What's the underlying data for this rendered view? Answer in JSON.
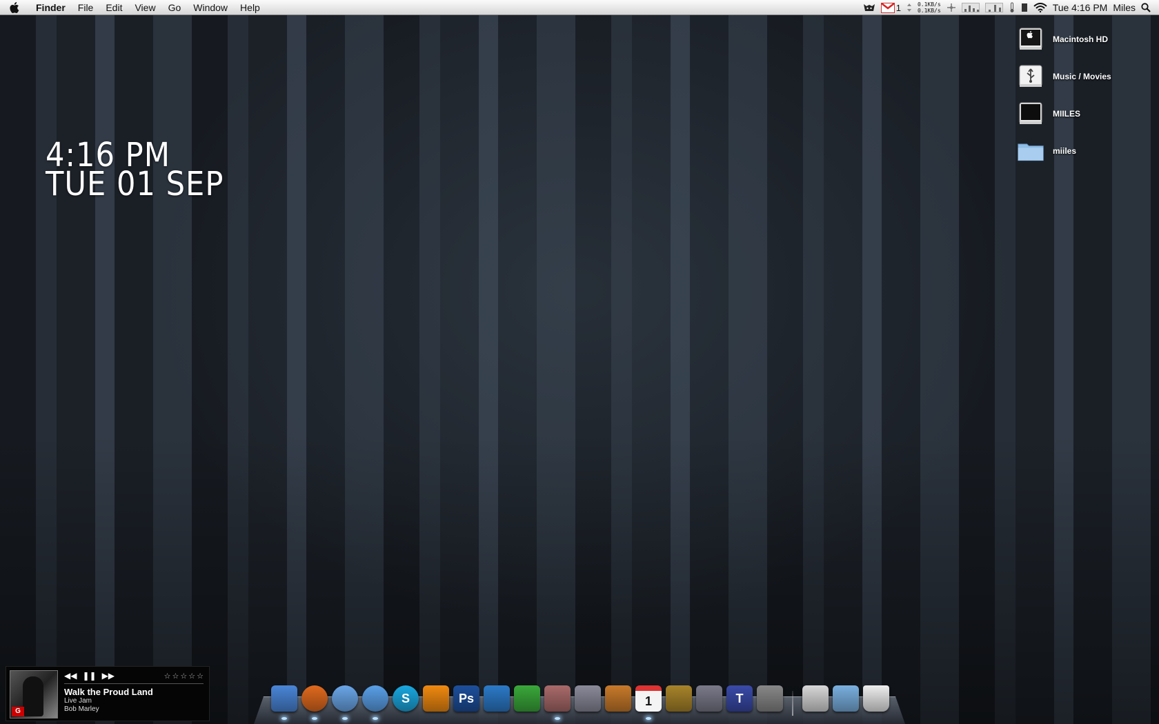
{
  "menubar": {
    "app_name": "Finder",
    "menus": [
      "File",
      "Edit",
      "View",
      "Go",
      "Window",
      "Help"
    ],
    "mail_count": "1",
    "net_up": "0.1KB/s",
    "net_down": "0.1KB/s",
    "clock": "Tue 4:16 PM",
    "user": "Miles"
  },
  "desktop_clock": {
    "time": "4:16 PM",
    "date": "TUE 01 SEP"
  },
  "desktop_icons": [
    {
      "label": "Macintosh HD",
      "icon": "hard-drive-icon"
    },
    {
      "label": "Music / Movies",
      "icon": "usb-drive-icon"
    },
    {
      "label": "MIILES",
      "icon": "external-drive-icon"
    },
    {
      "label": "miiles",
      "icon": "folder-icon"
    }
  ],
  "now_playing": {
    "title": "Walk the Proud Land",
    "album": "Live Jam",
    "artist": "Bob Marley",
    "rating_stars": 0
  },
  "dock": {
    "apps": [
      {
        "name": "finder",
        "color": "#4a86d8",
        "running": true
      },
      {
        "name": "firefox",
        "color": "#e06a1e",
        "running": true
      },
      {
        "name": "itunes",
        "color": "#6aa6e8",
        "running": true
      },
      {
        "name": "ichat",
        "color": "#5aa0e8",
        "running": true
      },
      {
        "name": "skype",
        "color": "#1aa8e0",
        "running": false
      },
      {
        "name": "vlc",
        "color": "#f08a10",
        "running": false
      },
      {
        "name": "photoshop",
        "color": "#1d4f9c",
        "running": false
      },
      {
        "name": "word-press",
        "color": "#2c7ac8",
        "running": false
      },
      {
        "name": "scrivener",
        "color": "#3aa83a",
        "running": false
      },
      {
        "name": "preview-app",
        "color": "#aa6a6a",
        "running": true
      },
      {
        "name": "address-book",
        "color": "#8a8a9a",
        "running": false
      },
      {
        "name": "iphoto",
        "color": "#c87a2a",
        "running": false
      },
      {
        "name": "ical",
        "color": "#e8e8e8",
        "running": true
      },
      {
        "name": "adium",
        "color": "#a8842a",
        "running": false
      },
      {
        "name": "imovie",
        "color": "#7a7a8a",
        "running": false
      },
      {
        "name": "textmate",
        "color": "#3a4aa8",
        "running": false
      },
      {
        "name": "system-preferences",
        "color": "#888888",
        "running": false
      }
    ],
    "docs": [
      {
        "name": "documents-stack",
        "color": "#d8d8d8"
      },
      {
        "name": "folder-stack",
        "color": "#7ab0e0"
      },
      {
        "name": "trash",
        "color": "#c8c8c8"
      }
    ],
    "app_glyphs": {
      "photoshop": "Ps",
      "textmate": "T",
      "skype": "S",
      "ical": "1"
    }
  }
}
